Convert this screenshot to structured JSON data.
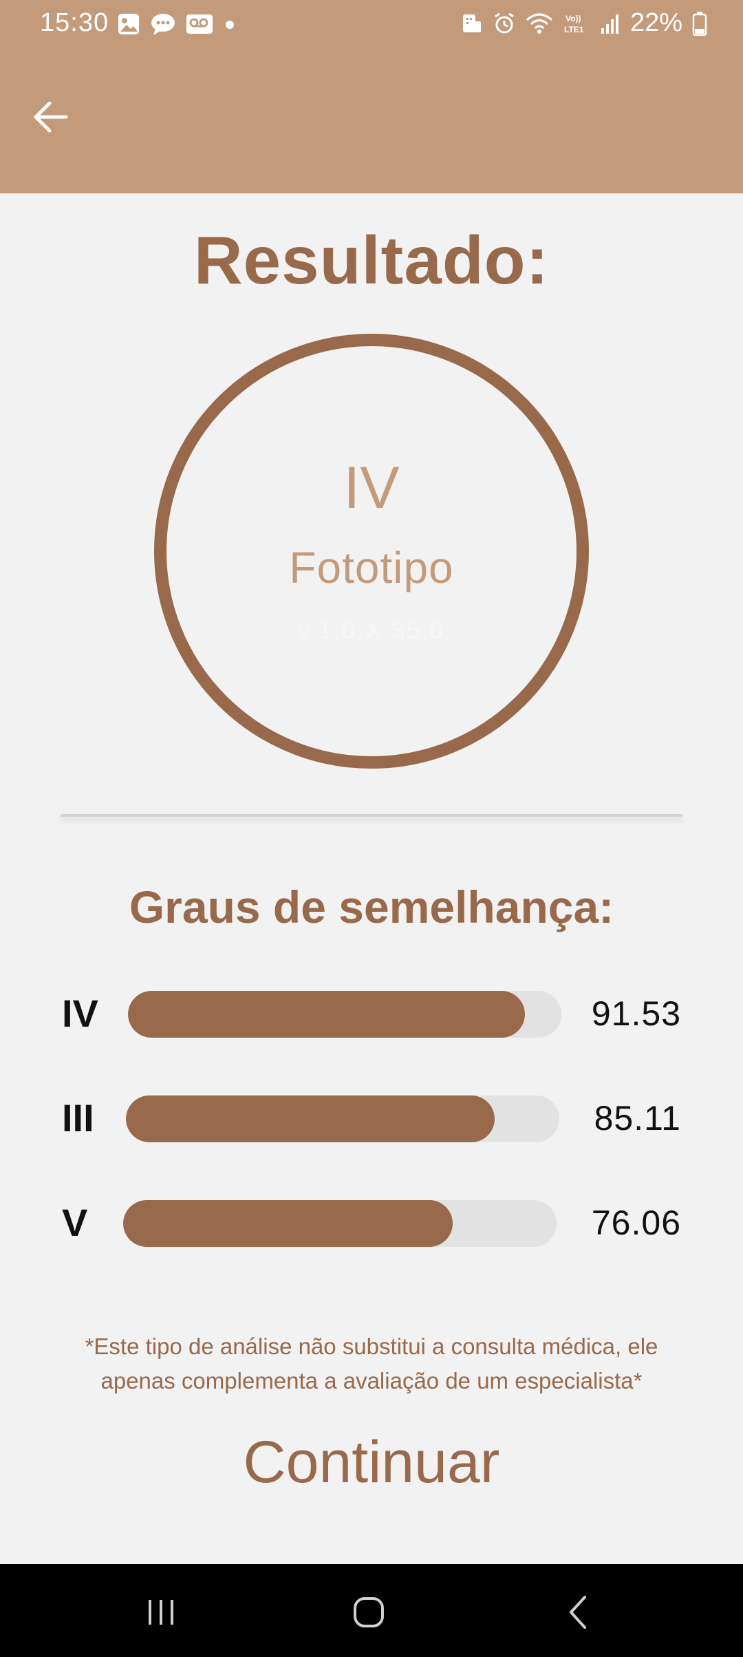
{
  "status_bar": {
    "time": "15:30",
    "battery": "22%",
    "icons_left": [
      "image-icon",
      "chat-icon",
      "voicemail-icon",
      "dot-icon"
    ],
    "icons_right": [
      "work-profile-icon",
      "alarm-icon",
      "wifi-icon",
      "volte-icon",
      "signal-icon",
      "battery-icon"
    ]
  },
  "app_bar": {
    "back_icon": "arrow-left-icon"
  },
  "main": {
    "title": "Resultado:",
    "result_type": "IV",
    "result_label": "Fototipo",
    "version": "v.1.0.X.35.0",
    "similarity_title": "Graus de semelhança:",
    "similarity": [
      {
        "label": "IV",
        "value": "91.53",
        "fill": 0.9153
      },
      {
        "label": "III",
        "value": "85.11",
        "fill": 0.8511
      },
      {
        "label": "V",
        "value": "76.06",
        "fill": 0.7606
      }
    ],
    "disclaimer": "*Este tipo de análise não substitui a consulta médica, ele apenas complementa a avaliação de um especialista*",
    "continue_label": "Continuar"
  },
  "colors": {
    "primary": "#98694a",
    "primary_light": "#c39b7b",
    "background": "#f2f2f2",
    "track": "#e2e2e2"
  },
  "nav_bar": {
    "buttons": [
      "recents-icon",
      "home-icon",
      "back-icon"
    ]
  }
}
